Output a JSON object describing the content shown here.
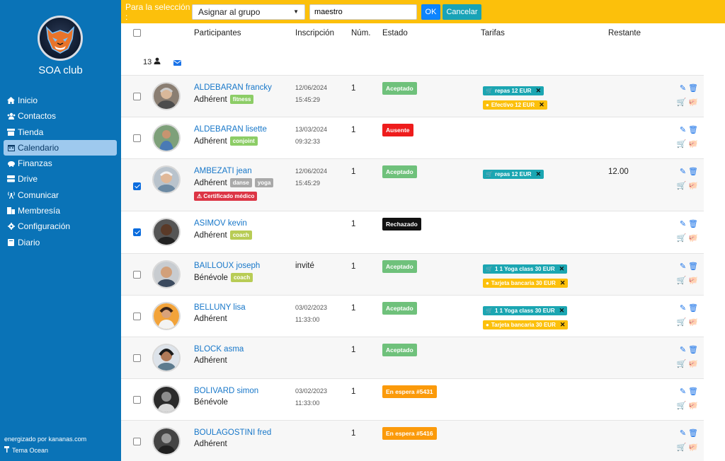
{
  "sidebar": {
    "club_name": "SOA club",
    "nav": [
      {
        "label": "Inicio",
        "icon": "home-icon"
      },
      {
        "label": "Contactos",
        "icon": "users-icon"
      },
      {
        "label": "Tienda",
        "icon": "store-icon"
      },
      {
        "label": "Calendario",
        "icon": "calendar-icon",
        "active": true
      },
      {
        "label": "Finanzas",
        "icon": "piggy-bank-icon"
      },
      {
        "label": "Drive",
        "icon": "drive-icon"
      },
      {
        "label": "Comunicar",
        "icon": "broadcast-icon"
      },
      {
        "label": "Membresía",
        "icon": "membership-icon"
      },
      {
        "label": "Configuración",
        "icon": "gear-icon"
      },
      {
        "label": "Diario",
        "icon": "book-icon"
      }
    ],
    "footer_powered": "energizado por kananas.com",
    "footer_theme": "Tema Ocean"
  },
  "topbar": {
    "label": "Para la selección :",
    "select_value": "Asignar al grupo",
    "input_value": "maestro",
    "ok": "OK",
    "cancel": "Cancelar"
  },
  "table": {
    "headers": {
      "participantes": "Participantes",
      "inscripcion": "Inscripción",
      "num": "Núm.",
      "estado": "Estado",
      "tarifas": "Tarifas",
      "restante": "Restante"
    },
    "count": "13",
    "rows": [
      {
        "name": "ALDEBARAN francky",
        "role": "Adhérent",
        "tags": [
          "fitness"
        ],
        "date": "12/06/2024",
        "time": "15:45:29",
        "num": "1",
        "status": "Aceptado",
        "tarifas": [
          "repas 12 EUR",
          "Efectivo 12 EUR"
        ],
        "checked": false
      },
      {
        "name": "ALDEBARAN lisette",
        "role": "Adhérent",
        "tags": [
          "conjoint"
        ],
        "date": "13/03/2024",
        "time": "09:32:33",
        "num": "1",
        "status": "Ausente",
        "tarifas": [],
        "checked": false
      },
      {
        "name": "AMBEZATI jean",
        "role": "Adhérent",
        "tags": [
          "danse",
          "yoga"
        ],
        "cert": "Certificado médico",
        "date": "12/06/2024",
        "time": "15:45:29",
        "num": "1",
        "status": "Aceptado",
        "tarifas": [
          "repas 12 EUR"
        ],
        "restante": "12.00",
        "checked": true
      },
      {
        "name": "ASIMOV kevin",
        "role": "Adhérent",
        "tags": [
          "coach"
        ],
        "date": "",
        "time": "",
        "num": "1",
        "status": "Rechazado",
        "tarifas": [],
        "checked": true
      },
      {
        "name": "BAILLOUX joseph",
        "role": "Bénévole",
        "tags": [
          "coach"
        ],
        "date": "invité",
        "time": "",
        "num": "1",
        "status": "Aceptado",
        "tarifas": [
          "1 1 Yoga class 30 EUR",
          "Tarjeta bancaria 30 EUR"
        ],
        "checked": false
      },
      {
        "name": "BELLUNY lisa",
        "role": "Adhérent",
        "tags": [],
        "date": "03/02/2023",
        "time": "11:33:00",
        "num": "1",
        "status": "Aceptado",
        "tarifas": [
          "1 1 Yoga class 30 EUR",
          "Tarjeta bancaria 30 EUR"
        ],
        "checked": false
      },
      {
        "name": "BLOCK asma",
        "role": "Adhérent",
        "tags": [],
        "date": "",
        "time": "",
        "num": "1",
        "status": "Aceptado",
        "tarifas": [],
        "checked": false
      },
      {
        "name": "BOLIVARD simon",
        "role": "Bénévole",
        "tags": [],
        "date": "03/02/2023",
        "time": "11:33:00",
        "num": "1",
        "status": "En espera #5431",
        "tarifas": [],
        "checked": false
      },
      {
        "name": "BOULAGOSTINI fred",
        "role": "Adhérent",
        "tags": [],
        "date": "",
        "time": "",
        "num": "1",
        "status": "En espera #5416",
        "tarifas": [],
        "checked": false
      }
    ]
  },
  "colors": {
    "sidebar": "#0a73b7",
    "topbar": "#fcc00b",
    "link": "#1777c9",
    "accepted": "#6fc17b",
    "absent": "#ee1c1c",
    "rejected": "#111111",
    "waiting": "#fb9a0a"
  }
}
